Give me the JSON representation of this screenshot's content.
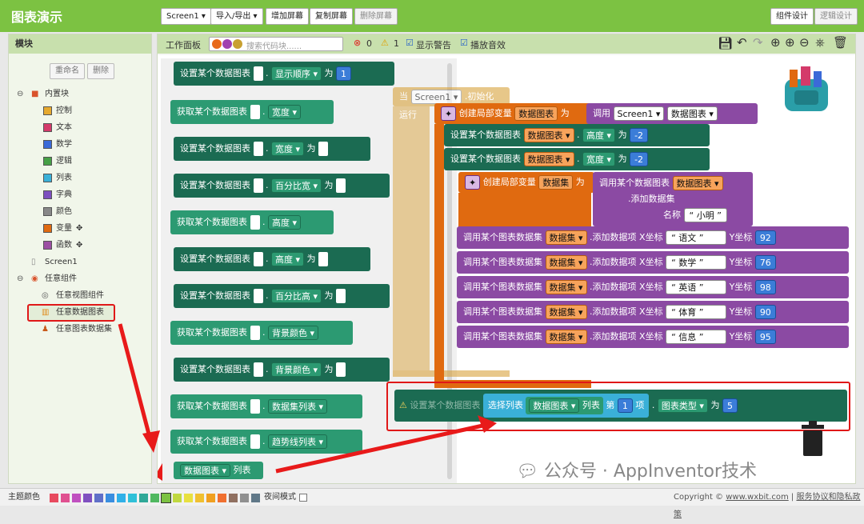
{
  "app_title": "图表演示",
  "toolbar": {
    "screen": "Screen1 ▾",
    "import_export": "导入/导出 ▾",
    "add_screen": "增加屏幕",
    "copy_screen": "复制屏幕",
    "delete_screen": "删除屏幕",
    "designer": "组件设计",
    "blocks": "逻辑设计"
  },
  "left": {
    "header": "模块",
    "rename": "重命名",
    "delete": "删除",
    "builtin": "内置块",
    "items": [
      "控制",
      "文本",
      "数学",
      "逻辑",
      "列表",
      "字典",
      "颜色",
      "变量",
      "函数"
    ],
    "screen": "Screen1",
    "any": "任意组件",
    "any_items": [
      "任意视图组件",
      "任意数据图表",
      "任意图表数据集"
    ]
  },
  "colors": {
    "control": "#e6a92e",
    "text": "#d43a6a",
    "math": "#3b6ad8",
    "logic": "#46a046",
    "list": "#3ab0d8",
    "dict": "#7d4fbf",
    "color": "#888888",
    "var": "#e06a10",
    "proc": "#9c4fa3"
  },
  "ws": {
    "header": "工作面板",
    "search": "搜索代码块......",
    "err": "0",
    "warn": "1",
    "show_warn": "显示警告",
    "play_sound": "播放音效"
  },
  "blocks": {
    "set_chart": "设置某个数据图表",
    "get_chart": "获取某个数据图表",
    "as": "为",
    "p_order": "显示顺序 ▾",
    "p_width": "宽度 ▾",
    "p_pwidth": "百分比宽 ▾",
    "p_height": "高度 ▾",
    "p_pheight": "百分比高 ▾",
    "p_bg": "背景颜色 ▾",
    "p_dslist": "数据集列表 ▾",
    "p_trend": "趋势线列表 ▾",
    "v1": "1",
    "chart_list_drop": "数据图表 ▾",
    "chart_list": "列表",
    "when": "当",
    "screen1": "Screen1 ▾",
    "init": ".初始化",
    "do": "运行",
    "create_local": "创建局部变量",
    "var_chart": "数据图表",
    "call": "调用",
    "screen1b": "Screen1 ▾",
    ".create": ".创建",
    "chart_drop": "数据图表 ▾",
    "set_v": "设置某个数据图表",
    "var_chart_drop": "数据图表 ▾",
    "height": "高度 ▾",
    "width": "宽度 ▾",
    "neg2": "-2",
    "var_ds": "数据集",
    "call_chart": "调用某个数据图表",
    "add_ds": ".添加数据集",
    "name_lbl": "名称",
    "xiaoming": "小明",
    "call_ds": "调用某个图表数据集",
    "ds_drop": "数据集 ▾",
    "add_item": ".添加数据项",
    "xlbl": "X坐标",
    "ylbl": "Y坐标",
    "items": [
      {
        "x": "语文",
        "y": "92"
      },
      {
        "x": "数学",
        "y": "76"
      },
      {
        "x": "英语",
        "y": "98"
      },
      {
        "x": "体育",
        "y": "90"
      },
      {
        "x": "信息",
        "y": "95"
      }
    ],
    "sel_list": "选择列表",
    "list": "列表",
    "nth": "第",
    "one": "1",
    "item": "项",
    "type": "图表类型 ▾",
    "five": "5"
  },
  "watermark": "公众号 · AppInventor技术",
  "bottom": {
    "theme": "主题颜色",
    "night": "夜间模式",
    "copyright": "Copyright © ",
    "site": "www.wxbit.com",
    "policy": "服务协议和隐私政策"
  }
}
